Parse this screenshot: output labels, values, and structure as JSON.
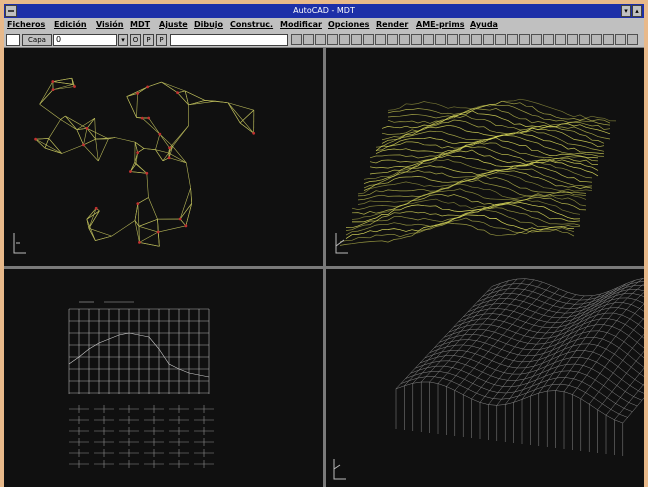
{
  "window": {
    "title": "AutoCAD - MDT"
  },
  "menu": {
    "items": [
      "Ficheros",
      "Edición",
      "Visión",
      "MDT",
      "Ajuste",
      "Dibujo",
      "Construc.",
      "Modificar",
      "Opciones",
      "Render",
      "AME-prims",
      "Ayuda"
    ]
  },
  "toolbar": {
    "layer_label": "Capa",
    "layer_value": "0",
    "toggle_o": "O",
    "toggle_p1": "P",
    "toggle_p2": "P"
  },
  "colors": {
    "titlebar": "#1d2fa8",
    "viewport_bg": "#101010",
    "drawing_yellow": "#d8d85a",
    "drawing_red": "#c03030",
    "wire_gray": "#9a9a9a"
  }
}
